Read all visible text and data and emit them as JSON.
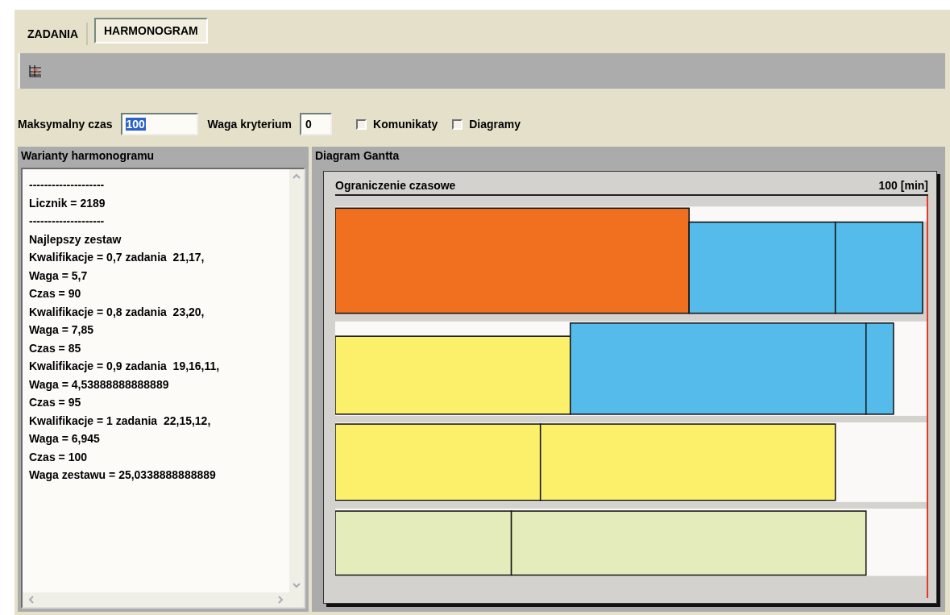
{
  "tabs": [
    {
      "label": "ZADANIA",
      "selected": false
    },
    {
      "label": "HARMONOGRAM",
      "selected": true
    }
  ],
  "fields": [
    {
      "label": "Maksymalny czas",
      "value": "100",
      "text_selected": true,
      "kind": "wide"
    },
    {
      "label": "Waga kryterium",
      "value": "0",
      "text_selected": false,
      "kind": "narrow"
    }
  ],
  "checkboxes": [
    {
      "label": "Komunikaty",
      "checked": false
    },
    {
      "label": "Diagramy",
      "checked": false
    }
  ],
  "variants_panel": {
    "title": "Warianty harmonogramu",
    "lines": [
      "--------------------",
      "Licznik = 2189",
      "--------------------",
      "Najlepszy zestaw",
      "Kwalifikacje = 0,7 zadania  21,17,",
      "Waga = 5,7",
      "Czas = 90",
      "Kwalifikacje = 0,8 zadania  23,20,",
      "Waga = 7,85",
      "Czas = 85",
      "Kwalifikacje = 0,9 zadania  19,16,11,",
      "Waga = 4,53888888888889",
      "Czas = 95",
      "Kwalifikacje = 1 zadania  22,15,12,",
      "Waga = 6,945",
      "Czas = 100",
      "Waga zestawu = 25,0338888888889"
    ]
  },
  "gantt_panel": {
    "title": "Diagram Gantta",
    "chart_title": "Ograniczenie czasowe",
    "limit_label": "100 [min]"
  }
}
